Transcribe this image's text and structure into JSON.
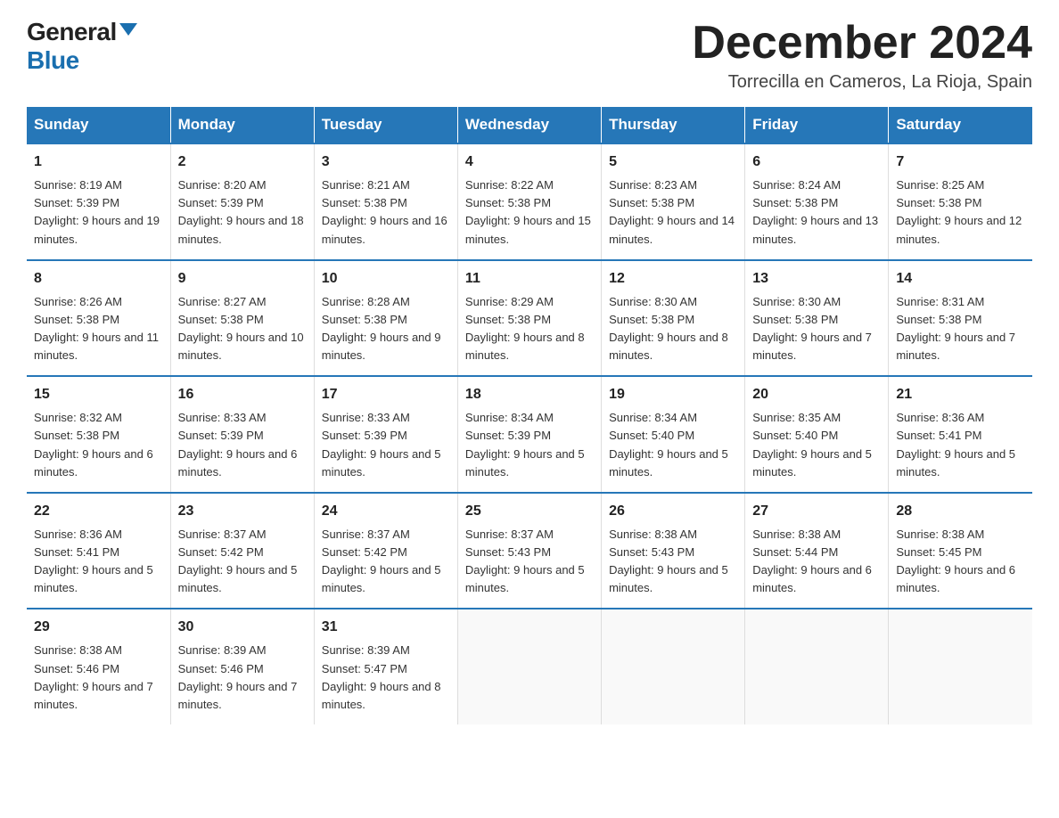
{
  "logo": {
    "general": "General",
    "blue": "Blue"
  },
  "title": "December 2024",
  "location": "Torrecilla en Cameros, La Rioja, Spain",
  "days_of_week": [
    "Sunday",
    "Monday",
    "Tuesday",
    "Wednesday",
    "Thursday",
    "Friday",
    "Saturday"
  ],
  "weeks": [
    [
      {
        "day": "1",
        "sunrise": "8:19 AM",
        "sunset": "5:39 PM",
        "daylight": "9 hours and 19 minutes."
      },
      {
        "day": "2",
        "sunrise": "8:20 AM",
        "sunset": "5:39 PM",
        "daylight": "9 hours and 18 minutes."
      },
      {
        "day": "3",
        "sunrise": "8:21 AM",
        "sunset": "5:38 PM",
        "daylight": "9 hours and 16 minutes."
      },
      {
        "day": "4",
        "sunrise": "8:22 AM",
        "sunset": "5:38 PM",
        "daylight": "9 hours and 15 minutes."
      },
      {
        "day": "5",
        "sunrise": "8:23 AM",
        "sunset": "5:38 PM",
        "daylight": "9 hours and 14 minutes."
      },
      {
        "day": "6",
        "sunrise": "8:24 AM",
        "sunset": "5:38 PM",
        "daylight": "9 hours and 13 minutes."
      },
      {
        "day": "7",
        "sunrise": "8:25 AM",
        "sunset": "5:38 PM",
        "daylight": "9 hours and 12 minutes."
      }
    ],
    [
      {
        "day": "8",
        "sunrise": "8:26 AM",
        "sunset": "5:38 PM",
        "daylight": "9 hours and 11 minutes."
      },
      {
        "day": "9",
        "sunrise": "8:27 AM",
        "sunset": "5:38 PM",
        "daylight": "9 hours and 10 minutes."
      },
      {
        "day": "10",
        "sunrise": "8:28 AM",
        "sunset": "5:38 PM",
        "daylight": "9 hours and 9 minutes."
      },
      {
        "day": "11",
        "sunrise": "8:29 AM",
        "sunset": "5:38 PM",
        "daylight": "9 hours and 8 minutes."
      },
      {
        "day": "12",
        "sunrise": "8:30 AM",
        "sunset": "5:38 PM",
        "daylight": "9 hours and 8 minutes."
      },
      {
        "day": "13",
        "sunrise": "8:30 AM",
        "sunset": "5:38 PM",
        "daylight": "9 hours and 7 minutes."
      },
      {
        "day": "14",
        "sunrise": "8:31 AM",
        "sunset": "5:38 PM",
        "daylight": "9 hours and 7 minutes."
      }
    ],
    [
      {
        "day": "15",
        "sunrise": "8:32 AM",
        "sunset": "5:38 PM",
        "daylight": "9 hours and 6 minutes."
      },
      {
        "day": "16",
        "sunrise": "8:33 AM",
        "sunset": "5:39 PM",
        "daylight": "9 hours and 6 minutes."
      },
      {
        "day": "17",
        "sunrise": "8:33 AM",
        "sunset": "5:39 PM",
        "daylight": "9 hours and 5 minutes."
      },
      {
        "day": "18",
        "sunrise": "8:34 AM",
        "sunset": "5:39 PM",
        "daylight": "9 hours and 5 minutes."
      },
      {
        "day": "19",
        "sunrise": "8:34 AM",
        "sunset": "5:40 PM",
        "daylight": "9 hours and 5 minutes."
      },
      {
        "day": "20",
        "sunrise": "8:35 AM",
        "sunset": "5:40 PM",
        "daylight": "9 hours and 5 minutes."
      },
      {
        "day": "21",
        "sunrise": "8:36 AM",
        "sunset": "5:41 PM",
        "daylight": "9 hours and 5 minutes."
      }
    ],
    [
      {
        "day": "22",
        "sunrise": "8:36 AM",
        "sunset": "5:41 PM",
        "daylight": "9 hours and 5 minutes."
      },
      {
        "day": "23",
        "sunrise": "8:37 AM",
        "sunset": "5:42 PM",
        "daylight": "9 hours and 5 minutes."
      },
      {
        "day": "24",
        "sunrise": "8:37 AM",
        "sunset": "5:42 PM",
        "daylight": "9 hours and 5 minutes."
      },
      {
        "day": "25",
        "sunrise": "8:37 AM",
        "sunset": "5:43 PM",
        "daylight": "9 hours and 5 minutes."
      },
      {
        "day": "26",
        "sunrise": "8:38 AM",
        "sunset": "5:43 PM",
        "daylight": "9 hours and 5 minutes."
      },
      {
        "day": "27",
        "sunrise": "8:38 AM",
        "sunset": "5:44 PM",
        "daylight": "9 hours and 6 minutes."
      },
      {
        "day": "28",
        "sunrise": "8:38 AM",
        "sunset": "5:45 PM",
        "daylight": "9 hours and 6 minutes."
      }
    ],
    [
      {
        "day": "29",
        "sunrise": "8:38 AM",
        "sunset": "5:46 PM",
        "daylight": "9 hours and 7 minutes."
      },
      {
        "day": "30",
        "sunrise": "8:39 AM",
        "sunset": "5:46 PM",
        "daylight": "9 hours and 7 minutes."
      },
      {
        "day": "31",
        "sunrise": "8:39 AM",
        "sunset": "5:47 PM",
        "daylight": "9 hours and 8 minutes."
      },
      null,
      null,
      null,
      null
    ]
  ]
}
